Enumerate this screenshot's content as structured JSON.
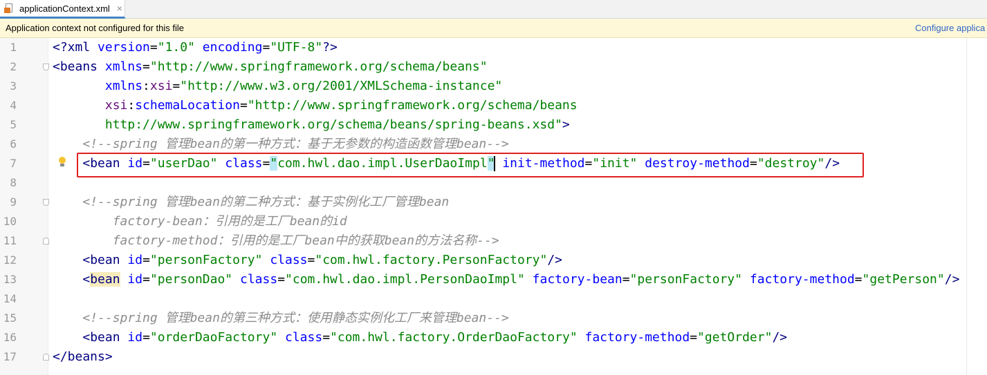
{
  "tab": {
    "title": "applicationContext.xml",
    "icon": "xml-file-icon",
    "close": "×"
  },
  "notice": {
    "message": "Application context not configured for this file",
    "link": "Configure applica"
  },
  "line_numbers": [
    "1",
    "2",
    "3",
    "4",
    "5",
    "6",
    "7",
    "8",
    "9",
    "10",
    "11",
    "12",
    "13",
    "14",
    "15",
    "16",
    "17"
  ],
  "code": {
    "l1": {
      "s1": "<?xml ",
      "s2": "version",
      "s3": "=",
      "s4": "\"1.0\"",
      "s5": " ",
      "s6": "encoding",
      "s7": "=",
      "s8": "\"UTF-8\"",
      "s9": "?>"
    },
    "l2": {
      "s1": "<beans ",
      "s2": "xmlns",
      "s3": "=",
      "s4": "\"http://www.springframework.org/schema/beans\""
    },
    "l3": {
      "s0": "       ",
      "s1": "xmlns",
      "s2": ":",
      "s3": "xsi",
      "s4": "=",
      "s5": "\"http://www.w3.org/2001/XMLSchema-instance\""
    },
    "l4": {
      "s0": "       ",
      "s1": "xsi",
      "s2": ":",
      "s3": "schemaLocation",
      "s4": "=",
      "s5": "\"http://www.springframework.org/schema/beans"
    },
    "l5": {
      "s0": "       ",
      "s1": "http://www.springframework.org/schema/beans/spring-beans.xsd\"",
      "s2": ">"
    },
    "l6": {
      "s0": "    ",
      "s1": "<!--spring 管理bean的第一种方式：基于无参数的构造函数管理bean-->"
    },
    "l7": {
      "s0": "    ",
      "s1": "<bean ",
      "s2": "id",
      "s3": "=",
      "s4": "\"userDao\"",
      "s5": " ",
      "s6": "class",
      "s7": "=",
      "s8": "\"",
      "s9": "com.hwl.dao.impl.UserDaoImpl",
      "s10": "\"",
      "s11": " ",
      "s12": "init-method",
      "s13": "=",
      "s14": "\"init\"",
      "s15": " ",
      "s16": "destroy-method",
      "s17": "=",
      "s18": "\"destroy\"",
      "s19": "/>"
    },
    "l9": {
      "s0": "    ",
      "s1": "<!--spring 管理bean的第二种方式：基于实例化工厂管理bean"
    },
    "l10": {
      "s0": "        ",
      "s1": "factory-bean：引用的是工厂bean的id"
    },
    "l11": {
      "s0": "        ",
      "s1": "factory-method：引用的是工厂bean中的获取bean的方法名称-->"
    },
    "l12": {
      "s0": "    ",
      "s1": "<bean ",
      "s2": "id",
      "s3": "=",
      "s4": "\"personFactory\"",
      "s5": " ",
      "s6": "class",
      "s7": "=",
      "s8": "\"com.hwl.factory.PersonFactory\"",
      "s9": "/>"
    },
    "l13": {
      "s0": "    ",
      "s1": "<",
      "s2": "bean",
      "s3": " ",
      "s4": "id",
      "s5": "=",
      "s6": "\"personDao\"",
      "s7": " ",
      "s8": "class",
      "s9": "=",
      "s10": "\"com.hwl.dao.impl.PersonDaoImpl\"",
      "s11": " ",
      "s12": "factory-bean",
      "s13": "=",
      "s14": "\"personFactory\"",
      "s15": " ",
      "s16": "factory-method",
      "s17": "=",
      "s18": "\"getPerson\"",
      "s19": "/>"
    },
    "l15": {
      "s0": "    ",
      "s1": "<!--spring 管理bean的第三种方式：使用静态实例化工厂来管理bean-->"
    },
    "l16": {
      "s0": "    ",
      "s1": "<bean ",
      "s2": "id",
      "s3": "=",
      "s4": "\"orderDaoFactory\"",
      "s5": " ",
      "s6": "class",
      "s7": "=",
      "s8": "\"com.hwl.factory.OrderDaoFactory\"",
      "s9": " ",
      "s10": "factory-method",
      "s11": "=",
      "s12": "\"getOrder\"",
      "s13": "/>"
    },
    "l17": {
      "s1": "</beans>"
    }
  },
  "colors": {
    "tag": "#000080",
    "attr": "#0000ff",
    "namespace": "#660e7a",
    "value": "#008000",
    "comment": "#8c8c8c",
    "highlight_box": "#e02020",
    "notice_bg": "#fff8d8",
    "link": "#2f65ca"
  },
  "icons": {
    "intention": "lightbulb-icon",
    "fold": "fold-marker-icon"
  }
}
